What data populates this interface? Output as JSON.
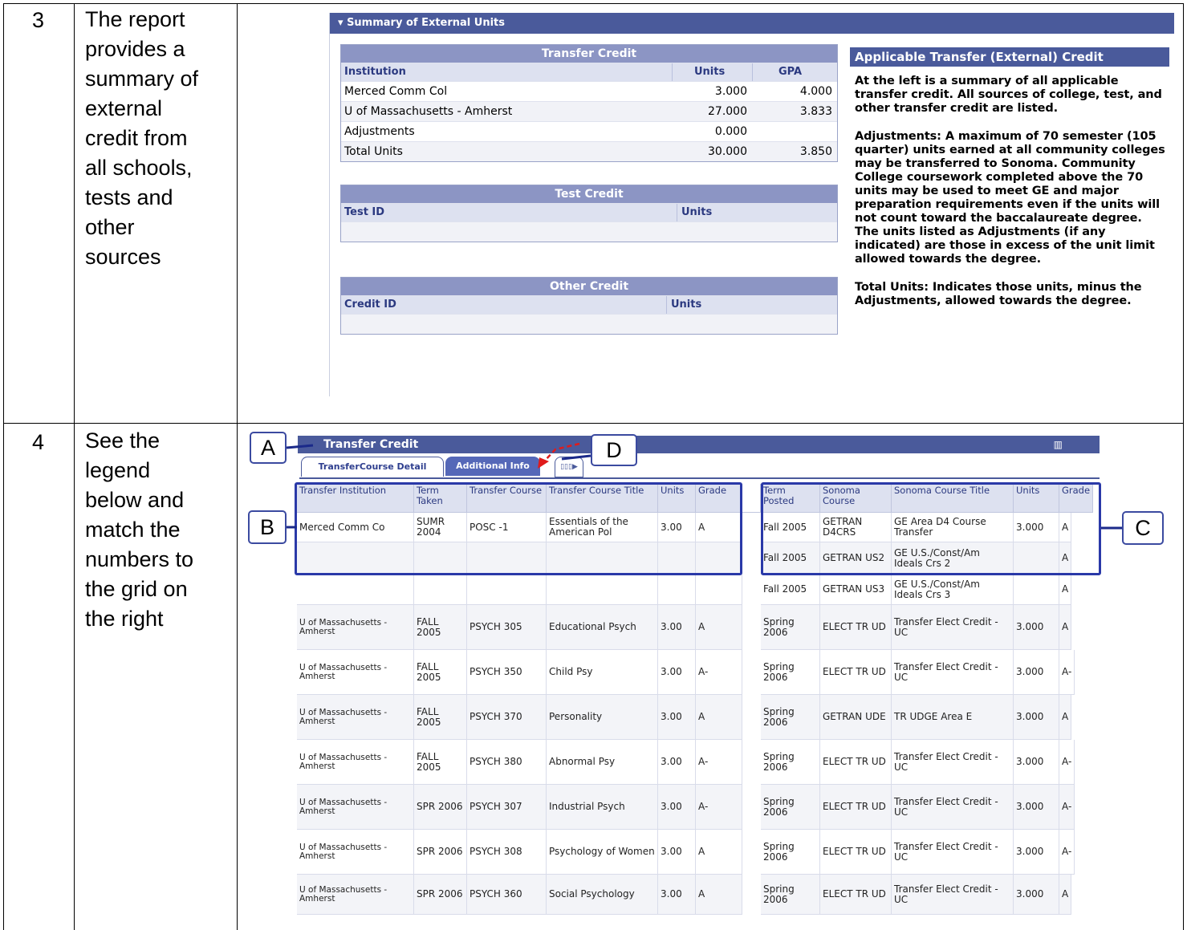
{
  "rows": [
    {
      "number": "3",
      "text_lines": [
        "The report",
        "provides a",
        "summary of",
        "external",
        "credit from",
        "all schools,",
        "tests and",
        "other",
        "sources"
      ]
    },
    {
      "number": "4",
      "text_lines": [
        "See the",
        "legend",
        "below and",
        "match the",
        "numbers to",
        "the grid on",
        "the right"
      ]
    }
  ],
  "summary": {
    "header": "Summary of External Units",
    "transfer_credit": {
      "title": "Transfer Credit",
      "columns": [
        "Institution",
        "Units",
        "GPA"
      ],
      "rows": [
        [
          "Merced Comm Col",
          "3.000",
          "4.000"
        ],
        [
          "U of Massachusetts - Amherst",
          "27.000",
          "3.833"
        ],
        [
          "Adjustments",
          "0.000",
          ""
        ],
        [
          "Total Units",
          "30.000",
          "3.850"
        ]
      ]
    },
    "test_credit": {
      "title": "Test Credit",
      "columns": [
        "Test ID",
        "Units"
      ]
    },
    "other_credit": {
      "title": "Other Credit",
      "columns": [
        "Credit ID",
        "Units"
      ]
    },
    "help": {
      "title": "Applicable Transfer (External) Credit",
      "paragraphs": [
        "At the left is a summary of all applicable transfer credit. All sources of college, test, and other transfer credit are listed.",
        "Adjustments: A maximum of 70 semester (105 quarter) units earned at all community colleges may be transferred to Sonoma. Community College coursework completed above the 70 units may be used to meet GE and major preparation requirements even if the units will not count toward the baccalaureate degree. The units listed as Adjustments (if any indicated) are those in excess of the unit limit allowed towards the degree.",
        "Total Units: Indicates those units, minus the Adjustments, allowed towards the degree."
      ]
    }
  },
  "transfer": {
    "header": "Transfer Credit",
    "tabs": [
      "TransferCourse Detail",
      "Additional Info",
      "▯▯▯▶"
    ],
    "columns": [
      "Transfer Institution",
      "Term Taken",
      "Transfer Course",
      "Transfer Course Title",
      "Units",
      "Grade",
      "Term Posted",
      "Sonoma Course",
      "Sonoma Course Title",
      "Units",
      "Grade"
    ],
    "rows": [
      [
        "Merced Comm Co",
        "SUMR 2004",
        "POSC -1",
        "Essentials of the American Pol",
        "3.00",
        "A",
        "Fall 2005",
        "GETRAN D4CRS",
        "GE Area D4 Course Transfer",
        "3.000",
        "A"
      ],
      [
        "",
        "",
        "",
        "",
        "",
        "",
        "Fall 2005",
        "GETRAN US2",
        "GE U.S./Const/Am Ideals Crs 2",
        "",
        "A"
      ],
      [
        "",
        "",
        "",
        "",
        "",
        "",
        "Fall 2005",
        "GETRAN US3",
        "GE U.S./Const/Am Ideals Crs 3",
        "",
        "A"
      ],
      [
        "U of Massachusetts - Amherst",
        "FALL 2005",
        "PSYCH 305",
        "Educational Psych",
        "3.00",
        "A",
        "Spring 2006",
        "ELECT TR UD",
        "Transfer Elect Credit - UC",
        "3.000",
        "A"
      ],
      [
        "U of Massachusetts - Amherst",
        "FALL 2005",
        "PSYCH 350",
        "Child Psy",
        "3.00",
        "A-",
        "Spring 2006",
        "ELECT TR UD",
        "Transfer Elect Credit - UC",
        "3.000",
        "A-"
      ],
      [
        "U of Massachusetts - Amherst",
        "FALL 2005",
        "PSYCH 370",
        "Personality",
        "3.00",
        "A",
        "Spring 2006",
        "GETRAN UDE",
        "TR UDGE Area E",
        "3.000",
        "A"
      ],
      [
        "U of Massachusetts - Amherst",
        "FALL 2005",
        "PSYCH 380",
        "Abnormal Psy",
        "3.00",
        "A-",
        "Spring 2006",
        "ELECT TR UD",
        "Transfer Elect Credit - UC",
        "3.000",
        "A-"
      ],
      [
        "U of Massachusetts - Amherst",
        "SPR 2006",
        "PSYCH 307",
        "Industrial Psych",
        "3.00",
        "A-",
        "Spring 2006",
        "ELECT TR UD",
        "Transfer Elect Credit - UC",
        "3.000",
        "A-"
      ],
      [
        "U of Massachusetts - Amherst",
        "SPR 2006",
        "PSYCH 308",
        "Psychology of Women",
        "3.00",
        "A",
        "Spring 2006",
        "ELECT TR UD",
        "Transfer Elect Credit - UC",
        "3.000",
        "A-"
      ],
      [
        "U of Massachusetts - Amherst",
        "SPR 2006",
        "PSYCH 360",
        "Social Psychology",
        "3.00",
        "A",
        "Spring 2006",
        "ELECT TR UD",
        "Transfer Elect Credit - UC",
        "3.000",
        "A"
      ]
    ],
    "callouts": [
      "A",
      "B",
      "C",
      "D"
    ]
  },
  "colors": {
    "header_blue": "#4a5a9b",
    "callout_blue": "#2a39a8",
    "arrow_red": "#e01b1b"
  }
}
